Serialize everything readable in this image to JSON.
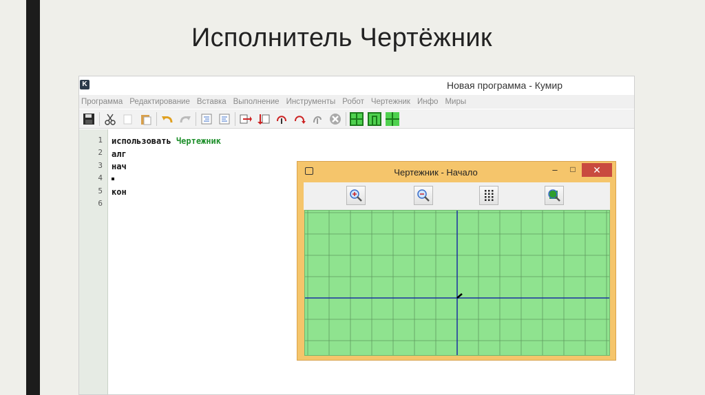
{
  "slide": {
    "title": "Исполнитель Чертёжник"
  },
  "window": {
    "logo": "K",
    "title": "Новая программа - Кумир"
  },
  "menu": [
    "Программа",
    "Редактирование",
    "Вставка",
    "Выполнение",
    "Инструменты",
    "Робот",
    "Чертежник",
    "Инфо",
    "Миры"
  ],
  "toolbar_icons": [
    "save-icon",
    "cut-icon",
    "copy-icon",
    "paste-icon",
    "undo-icon",
    "redo-icon",
    "indent-icon",
    "unindent-icon",
    "run-step-icon",
    "run-to-end-icon",
    "step-into-icon",
    "step-out-icon",
    "step-over-icon",
    "stop-icon",
    "robot-field-icon",
    "robot-window-icon",
    "drawer-field-icon"
  ],
  "editor": {
    "line_numbers": [
      "1",
      "2",
      "3",
      "4",
      "5",
      "6"
    ],
    "lines": [
      {
        "keyword": "использовать",
        "arg": "Чертежник"
      },
      {
        "keyword": "алг",
        "arg": ""
      },
      {
        "keyword": "нач",
        "arg": ""
      },
      {
        "keyword": "",
        "arg": ""
      },
      {
        "keyword": "кон",
        "arg": ""
      },
      {
        "keyword": "",
        "arg": ""
      }
    ]
  },
  "drawer_window": {
    "title": "Чертежник - Начало",
    "minimize": "–",
    "maximize": "□",
    "close": "✕",
    "buttons": [
      "zoom-in-icon",
      "zoom-out-icon",
      "grid-dots-icon",
      "fit-view-icon"
    ],
    "colors": {
      "canvas": "#8fe38f",
      "grid": "#5f9a5f",
      "axes": "#1a2fa0",
      "pen": "#000000"
    },
    "grid_step": 1,
    "pen_position": [
      0,
      0
    ]
  }
}
